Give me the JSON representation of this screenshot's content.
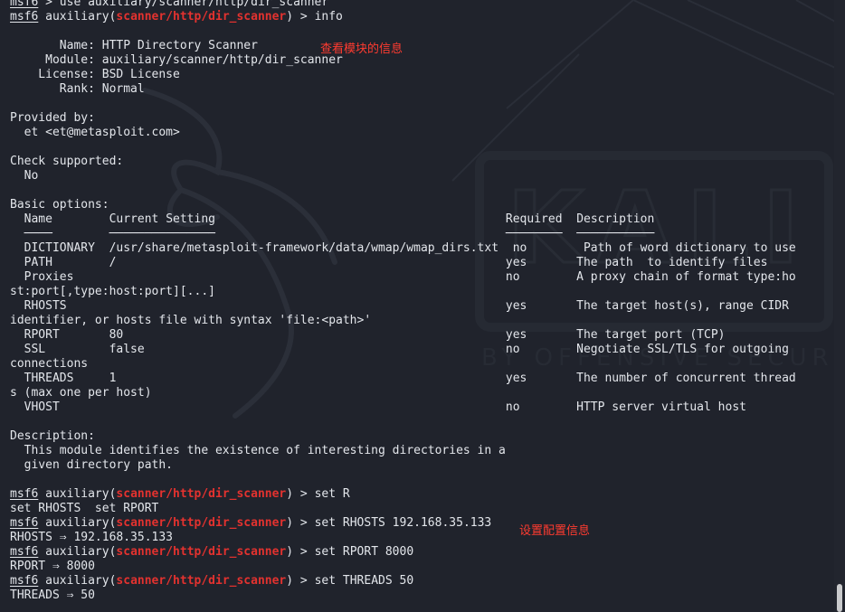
{
  "prompt": {
    "name": "msf6",
    "module_prefix": "auxiliary(",
    "module": "scanner/http/dir_scanner",
    "module_suffix": ") > "
  },
  "lines": {
    "cmd_use": "use auxiliary/scanner/http/dir_scanner",
    "cmd_info": "info",
    "name_line": "       Name: HTTP Directory Scanner",
    "module_line": "     Module: auxiliary/scanner/http/dir_scanner",
    "license_line": "    License: BSD License",
    "rank_line": "       Rank: Normal",
    "provided_by": "Provided by:",
    "author": "  et <et@metasploit.com>",
    "check_supported": "Check supported:",
    "check_value": "  No",
    "basic_options": "Basic options:",
    "hdr_name": "Name",
    "hdr_setting": "Current Setting",
    "hdr_required": "Required",
    "hdr_description": "Description",
    "underline_name": "────",
    "underline_setting": "───────────────",
    "underline_required": "────────",
    "underline_description": "───────────",
    "opt_dictionary": "  DICTIONARY  /usr/share/metasploit-framework/data/wmap/wmap_dirs.txt  no        Path of word dictionary to use",
    "opt_path": "  PATH        /                                                       yes       The path  to identify files",
    "opt_proxies": "  Proxies                                                             no        A proxy chain of format type:ho",
    "opt_proxies_wrap": "st:port[,type:host:port][...]",
    "opt_rhosts": "  RHOSTS                                                              yes       The target host(s), range CIDR",
    "opt_rhosts_wrap": "identifier, or hosts file with syntax 'file:<path>'",
    "opt_rport": "  RPORT       80                                                      yes       The target port (TCP)",
    "opt_ssl": "  SSL         false                                                   no        Negotiate SSL/TLS for outgoing",
    "opt_ssl_wrap": "connections",
    "opt_threads": "  THREADS     1                                                       yes       The number of concurrent thread",
    "opt_threads_wrap": "s (max one per host)",
    "opt_vhost": "  VHOST                                                               no        HTTP server virtual host",
    "description_label": "Description:",
    "description_1": "  This module identifies the existence of interesting directories in a",
    "description_2": "  given directory path.",
    "cmd_set_r": "set R",
    "tab_completion": "set RHOSTS  set RPORT",
    "cmd_set_rhosts": "set RHOSTS 192.168.35.133",
    "out_rhosts": "RHOSTS ⇒ 192.168.35.133",
    "cmd_set_rport": "set RPORT 8000",
    "out_rport": "RPORT ⇒ 8000",
    "cmd_set_threads": "set THREADS 50",
    "out_threads": "THREADS ⇒ 50"
  },
  "annotations": {
    "info_note": "查看模块的信息",
    "config_note": "设置配置信息"
  },
  "colors": {
    "background": "#20232c",
    "text": "#e3e6eb",
    "module_red": "#e3322f",
    "annotation_red": "#ff3b30"
  }
}
